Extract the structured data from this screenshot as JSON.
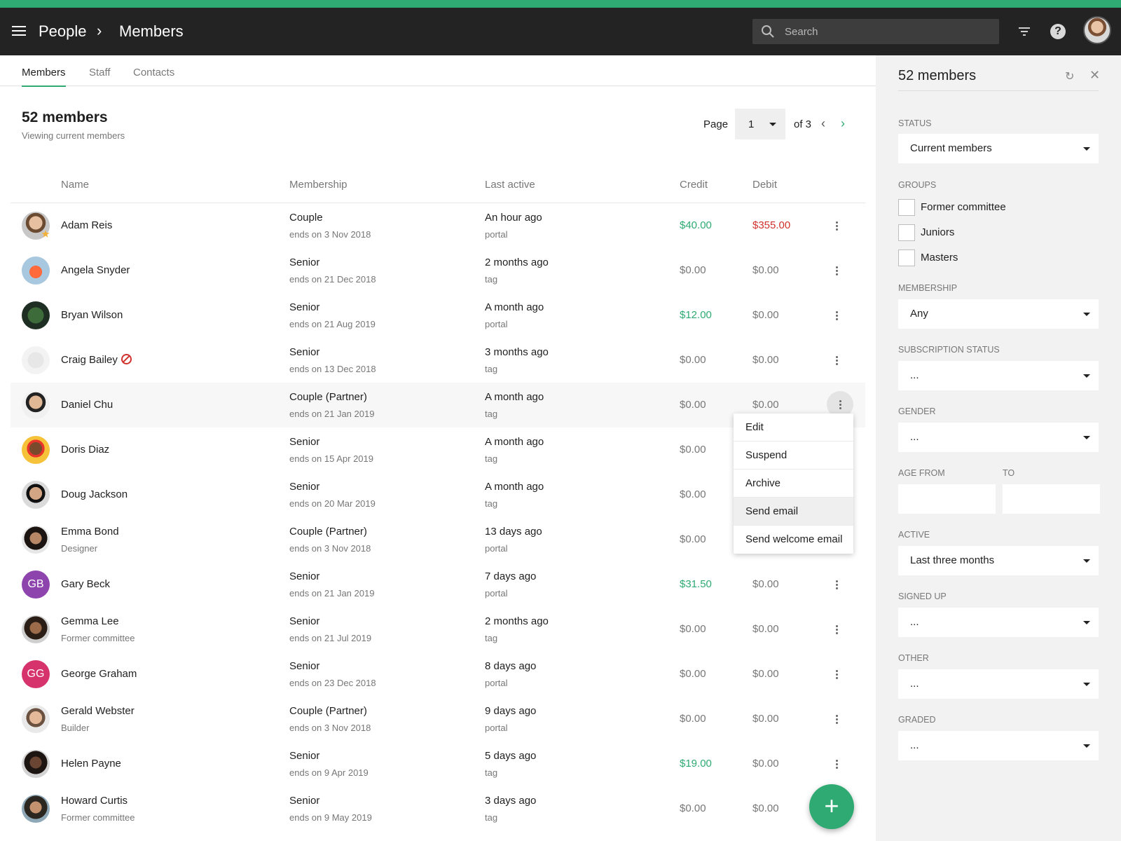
{
  "appbar": {
    "breadcrumb_root": "People",
    "breadcrumb_sep": "›",
    "breadcrumb_current": "Members",
    "search_placeholder": "Search",
    "help_glyph": "?",
    "icons": [
      "menu-icon",
      "search-icon",
      "filter-icon",
      "help-icon",
      "user-avatar"
    ]
  },
  "colors": {
    "accent": "#2eaa72",
    "negative": "#d0312d",
    "appbar": "#232323"
  },
  "tabs": [
    "Members",
    "Staff",
    "Contacts"
  ],
  "main": {
    "title": "52 members",
    "subtitle": "Viewing current members",
    "pager": {
      "label": "Page",
      "value": "1",
      "of": "of 3",
      "prev": "‹",
      "next": "›"
    }
  },
  "table": {
    "headers": [
      "Name",
      "Membership",
      "Last active",
      "Credit",
      "Debit"
    ],
    "rows": [
      {
        "name": "Adam Reis",
        "sub": "",
        "membership": "Couple",
        "ends": "ends on 3 Nov 2018",
        "active": "An hour ago",
        "via": "portal",
        "credit": "$40.00",
        "debit": "$355.00"
      },
      {
        "name": "Angela Snyder",
        "sub": "",
        "membership": "Senior",
        "ends": "ends on 21 Dec 2018",
        "active": "2 months ago",
        "via": "tag",
        "credit": "$0.00",
        "debit": "$0.00"
      },
      {
        "name": "Bryan Wilson",
        "sub": "",
        "membership": "Senior",
        "ends": "ends on 21 Aug 2019",
        "active": "A month ago",
        "via": "portal",
        "credit": "$12.00",
        "debit": "$0.00"
      },
      {
        "name": "Craig Bailey",
        "sub": "",
        "membership": "Senior",
        "ends": "ends on 13 Dec 2018",
        "active": "3 months ago",
        "via": "tag",
        "credit": "$0.00",
        "debit": "$0.00"
      },
      {
        "name": "Daniel Chu",
        "sub": "",
        "membership": "Couple (Partner)",
        "ends": "ends on 21 Jan 2019",
        "active": "A month ago",
        "via": "tag",
        "credit": "$0.00",
        "debit": "$0.00"
      },
      {
        "name": "Doris Diaz",
        "sub": "",
        "membership": "Senior",
        "ends": "ends on 15 Apr 2019",
        "active": "A month ago",
        "via": "tag",
        "credit": "$0.00",
        "debit": ""
      },
      {
        "name": "Doug Jackson",
        "sub": "",
        "membership": "Senior",
        "ends": "ends on 20 Mar 2019",
        "active": "A month ago",
        "via": "tag",
        "credit": "$0.00",
        "debit": ""
      },
      {
        "name": "Emma Bond",
        "sub": "Designer",
        "membership": "Couple (Partner)",
        "ends": "ends on 3 Nov 2018",
        "active": "13 days ago",
        "via": "portal",
        "credit": "$0.00",
        "debit": ""
      },
      {
        "name": "Gary Beck",
        "sub": "",
        "initials": "GB",
        "membership": "Senior",
        "ends": "ends on 21 Jan 2019",
        "active": "7 days ago",
        "via": "portal",
        "credit": "$31.50",
        "debit": "$0.00"
      },
      {
        "name": "Gemma Lee",
        "sub": "Former committee",
        "membership": "Senior",
        "ends": "ends on 21 Jul 2019",
        "active": "2 months ago",
        "via": "tag",
        "credit": "$0.00",
        "debit": "$0.00"
      },
      {
        "name": "George Graham",
        "sub": "",
        "initials": "GG",
        "membership": "Senior",
        "ends": "ends on 23 Dec 2018",
        "active": "8 days ago",
        "via": "portal",
        "credit": "$0.00",
        "debit": "$0.00"
      },
      {
        "name": "Gerald Webster",
        "sub": "Builder",
        "membership": "Couple (Partner)",
        "ends": "ends on 3 Nov 2018",
        "active": "9 days ago",
        "via": "portal",
        "credit": "$0.00",
        "debit": "$0.00"
      },
      {
        "name": "Helen Payne",
        "sub": "",
        "membership": "Senior",
        "ends": "ends on 9 Apr 2019",
        "active": "5 days ago",
        "via": "tag",
        "credit": "$19.00",
        "debit": "$0.00"
      },
      {
        "name": "Howard Curtis",
        "sub": "Former committee",
        "membership": "Senior",
        "ends": "ends on 9 May 2019",
        "active": "3 days ago",
        "via": "tag",
        "credit": "$0.00",
        "debit": "$0.00"
      }
    ]
  },
  "context_menu": [
    "Edit",
    "Suspend",
    "Archive",
    "Send email",
    "Send welcome email"
  ],
  "fab": {
    "glyph": "+"
  },
  "filters": {
    "title": "52 members",
    "refresh_glyph": "↻",
    "close_glyph": "✕",
    "status_label": "STATUS",
    "status_value": "Current members",
    "groups_label": "GROUPS",
    "groups": [
      "Former committee",
      "Juniors",
      "Masters"
    ],
    "membership_label": "MEMBERSHIP",
    "membership_value": "Any",
    "subscription_label": "SUBSCRIPTION STATUS",
    "subscription_value": "...",
    "gender_label": "GENDER",
    "gender_value": "...",
    "age_from_label": "AGE FROM",
    "age_to_label": "TO",
    "active_label": "ACTIVE",
    "active_value": "Last three months",
    "signed_up_label": "SIGNED UP",
    "signed_up_value": "...",
    "other_label": "OTHER",
    "other_value": "...",
    "graded_label": "GRADED",
    "graded_value": "..."
  }
}
